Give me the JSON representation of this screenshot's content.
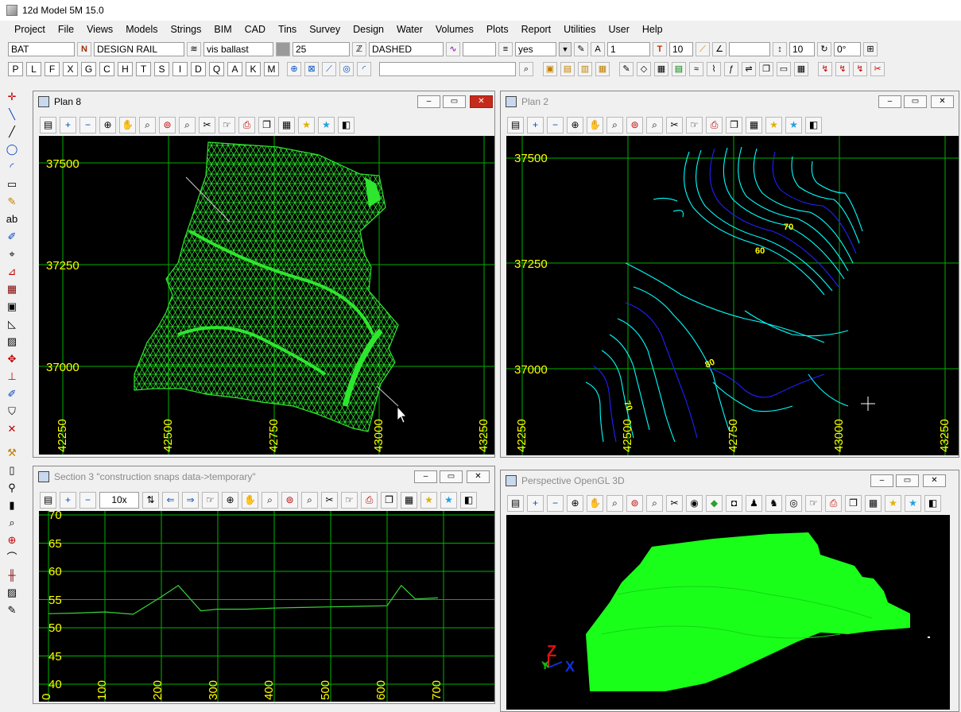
{
  "app": {
    "title": "12d Model 5M 15.0"
  },
  "menu": [
    "Project",
    "File",
    "Views",
    "Models",
    "Strings",
    "BIM",
    "CAD",
    "Tins",
    "Survey",
    "Design",
    "Water",
    "Volumes",
    "Plots",
    "Report",
    "Utilities",
    "User",
    "Help"
  ],
  "toolbar1": {
    "model": "BAT",
    "string_name": "DESIGN RAIL",
    "tin": "vis ballast",
    "colour_value": "25",
    "linestyle": "DASHED",
    "weight": "",
    "flag": "yes",
    "text_style": "1",
    "text_size": "10",
    "angle_blank": "",
    "height": "10",
    "angle": "0°"
  },
  "toolbar2": {
    "letters": [
      "P",
      "L",
      "F",
      "X",
      "G",
      "C",
      "H",
      "T",
      "S",
      "I",
      "D",
      "Q",
      "A",
      "K",
      "M"
    ],
    "search": ""
  },
  "windows": {
    "plan8": {
      "title": "Plan 8",
      "y_labels": [
        "37500",
        "37250",
        "37000"
      ],
      "x_labels": [
        "42250",
        "42500",
        "42750",
        "43000",
        "43250"
      ]
    },
    "plan2": {
      "title": "Plan 2",
      "y_labels": [
        "37500",
        "37250",
        "37000"
      ],
      "x_labels": [
        "42250",
        "42500",
        "42750",
        "43000",
        "43250"
      ],
      "contour_labels": [
        "70",
        "60",
        "80",
        "70"
      ]
    },
    "section3": {
      "title": "Section 3 \"construction snaps data->temporary\"",
      "scale": "10x",
      "y_labels": [
        "70",
        "65",
        "60",
        "55",
        "50",
        "45",
        "40"
      ],
      "x_labels": [
        "0",
        "100",
        "200",
        "300",
        "400",
        "500",
        "600",
        "700"
      ]
    },
    "persp": {
      "title": "Perspective OpenGL 3D",
      "axis_z": "Z",
      "axis_y": "Y",
      "axis_x": "X"
    }
  },
  "chart_data": {
    "type": "line",
    "title": "Section 3 \"construction snaps data->temporary\"",
    "x": [
      0,
      50,
      100,
      150,
      200,
      230,
      270,
      300,
      350,
      400,
      450,
      500,
      550,
      600,
      625,
      650,
      690
    ],
    "y": [
      52.5,
      52.6,
      52.8,
      52.4,
      55.5,
      57.5,
      53.0,
      53.3,
      53.3,
      53.5,
      53.6,
      53.7,
      53.8,
      53.9,
      57.5,
      55.1,
      55.3
    ],
    "xlim": [
      -5,
      710
    ],
    "ylim": [
      40,
      70
    ],
    "grid": true,
    "colors": {
      "line": "#3ad33a",
      "grid": "#00b300",
      "labels": "#ffff00"
    }
  },
  "colors": {
    "tin": "#2ee62e",
    "contour_cyan": "#00ffff",
    "contour_blue": "#2020ff",
    "grid": "#00b000",
    "text": "#ffff00"
  }
}
